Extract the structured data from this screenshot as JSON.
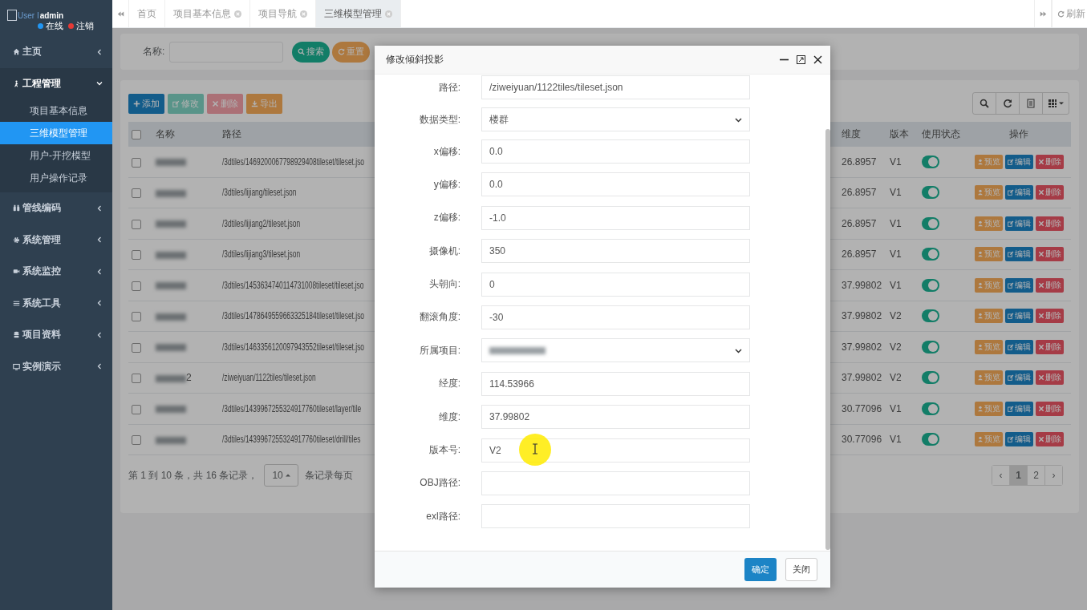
{
  "sidebar": {
    "user": {
      "image_alt": "User I",
      "name": "admin",
      "status": [
        {
          "label": "在线",
          "color": "#2196f3"
        },
        {
          "label": "注销",
          "color": "#e53935"
        }
      ]
    },
    "menu": [
      {
        "label": "主页",
        "expanded": false
      },
      {
        "label": "工程管理",
        "expanded": true,
        "children": [
          {
            "label": "项目基本信息",
            "selected": false
          },
          {
            "label": "三维模型管理",
            "selected": true
          },
          {
            "label": "用户-开挖模型",
            "selected": false
          },
          {
            "label": "用户操作记录",
            "selected": false
          }
        ]
      },
      {
        "label": "管线编码",
        "expanded": false
      },
      {
        "label": "系统管理",
        "expanded": false
      },
      {
        "label": "系统监控",
        "expanded": false
      },
      {
        "label": "系统工具",
        "expanded": false
      },
      {
        "label": "项目资料",
        "expanded": false
      },
      {
        "label": "实例演示",
        "expanded": false
      }
    ]
  },
  "tabs": [
    {
      "label": "首页",
      "closable": false,
      "selected": false
    },
    {
      "label": "项目基本信息",
      "closable": true,
      "selected": false
    },
    {
      "label": "项目导航",
      "closable": true,
      "selected": false
    },
    {
      "label": "三维模型管理",
      "closable": true,
      "selected": true
    }
  ],
  "refresh": "刷新",
  "search": {
    "label": "名称:",
    "buttons": [
      {
        "label": "搜索",
        "kind": "success"
      },
      {
        "label": "重置",
        "kind": "warning"
      }
    ]
  },
  "toolbar": [
    {
      "label": "添加",
      "kind": "primary",
      "disabled": false
    },
    {
      "label": "修改",
      "kind": "success",
      "disabled": true
    },
    {
      "label": "删除",
      "kind": "danger",
      "disabled": true
    },
    {
      "label": "导出",
      "kind": "warning",
      "disabled": false
    }
  ],
  "table": {
    "select_all": false,
    "columns": [
      "名称",
      "路径",
      "维度",
      "版本",
      "使用状态",
      "操作"
    ],
    "rows": [
      {
        "checked": false,
        "path": "/3dtiles/1469200067798929408tileset/tileset.jso",
        "lat": "26.8957",
        "version": "V1",
        "enabled": true,
        "actions": [
          "预览",
          "编辑",
          "删除"
        ]
      },
      {
        "checked": false,
        "path": "/3dtiles/lijiang/tileset.json",
        "lat": "26.8957",
        "version": "V1",
        "enabled": true,
        "actions": [
          "预览",
          "编辑",
          "删除"
        ]
      },
      {
        "checked": false,
        "path": "/3dtiles/lijiang2/tileset.json",
        "lat": "26.8957",
        "version": "V1",
        "enabled": true,
        "actions": [
          "预览",
          "编辑",
          "删除"
        ]
      },
      {
        "checked": false,
        "path": "/3dtiles/lijiang3/tileset.json",
        "lat": "26.8957",
        "version": "V1",
        "enabled": true,
        "actions": [
          "预览",
          "编辑",
          "删除"
        ]
      },
      {
        "checked": false,
        "path": "/3dtiles/1453634740114731008tileset/tileset.jso",
        "lat": "37.99802",
        "version": "V1",
        "enabled": true,
        "actions": [
          "预览",
          "编辑",
          "删除"
        ]
      },
      {
        "checked": false,
        "path": "/3dtiles/1478649559663325184tileset/tileset.jso",
        "lat": "37.99802",
        "version": "V2",
        "enabled": true,
        "actions": [
          "预览",
          "编辑",
          "删除"
        ]
      },
      {
        "checked": false,
        "path": "/3dtiles/1463356120097943552tileset/tileset.jso",
        "lat": "37.99802",
        "version": "V2",
        "enabled": true,
        "actions": [
          "预览",
          "编辑",
          "删除"
        ]
      },
      {
        "checked": false,
        "name_tail": "2",
        "path": "/ziweiyuan/1122tiles/tileset.json",
        "lat": "37.99802",
        "version": "V2",
        "enabled": true,
        "actions": [
          "预览",
          "编辑",
          "删除"
        ]
      },
      {
        "checked": false,
        "path": "/3dtiles/1439967255324917760tileset/layer/tile",
        "lat": "30.77096",
        "version": "V1",
        "enabled": true,
        "actions": [
          "预览",
          "编辑",
          "删除"
        ]
      },
      {
        "checked": false,
        "path": "/3dtiles/1439967255324917760tileset/drill/tiles",
        "lat": "30.77096",
        "version": "V1",
        "enabled": true,
        "actions": [
          "预览",
          "编辑",
          "删除"
        ]
      }
    ]
  },
  "pagination": {
    "summary": "第 1 到 10 条，共 16 条记录，",
    "page_size": "10",
    "page_size_suffix": "条记录每页",
    "prev": "‹",
    "next": "›",
    "pages": [
      {
        "label": "1",
        "selected": true
      },
      {
        "label": "2",
        "selected": false
      }
    ]
  },
  "modal": {
    "title": "修改倾斜投影",
    "fields": [
      {
        "label": "路径:",
        "kind": "text",
        "value": "/ziweiyuan/1122tiles/tileset.json"
      },
      {
        "label": "数据类型:",
        "kind": "select",
        "value": "楼群"
      },
      {
        "label": "x偏移:",
        "kind": "text",
        "value": "0.0"
      },
      {
        "label": "y偏移:",
        "kind": "text",
        "value": "0.0"
      },
      {
        "label": "z偏移:",
        "kind": "text",
        "value": "-1.0"
      },
      {
        "label": "摄像机:",
        "kind": "text",
        "value": "350"
      },
      {
        "label": "头朝向:",
        "kind": "text",
        "value": "0"
      },
      {
        "label": "翻滚角度:",
        "kind": "text",
        "value": "-30"
      },
      {
        "label": "所属项目:",
        "kind": "select",
        "blurred": true
      },
      {
        "label": "经度:",
        "kind": "text",
        "value": "114.53966"
      },
      {
        "label": "维度:",
        "kind": "text",
        "value": "37.99802"
      },
      {
        "label": "版本号:",
        "kind": "text",
        "value": "V2"
      },
      {
        "label": "OBJ路径:",
        "kind": "text"
      },
      {
        "label": "exl路径:",
        "kind": "text"
      }
    ],
    "buttons": [
      {
        "label": "确定",
        "kind": "primary"
      },
      {
        "label": "关闭",
        "kind": "default"
      }
    ]
  }
}
